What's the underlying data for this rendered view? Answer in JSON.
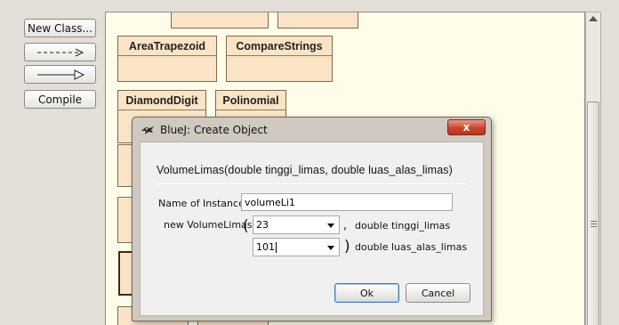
{
  "toolbar": {
    "new_class_label": "New Class...",
    "dependency_arrow_icon": "dashed-arrow-icon",
    "inheritance_arrow_icon": "hollow-arrow-icon",
    "compile_label": "Compile"
  },
  "classes": [
    {
      "name": "AreaTrapezoid"
    },
    {
      "name": "CompareStrings"
    },
    {
      "name": "DiamondDigit"
    },
    {
      "name": "Polinomial"
    }
  ],
  "dialog": {
    "title": "BlueJ:  Create Object",
    "close_label": "x",
    "constructor_signature": "VolumeLimas(double tinggi_limas, double luas_alas_limas)",
    "instance_label": "Name of Instance:",
    "instance_value": "volumeLi1",
    "new_label": "new VolumeLimas",
    "open_paren": "(",
    "close_paren": ")",
    "params": [
      {
        "value": "23",
        "separator": ",",
        "type_label": "double tinggi_limas"
      },
      {
        "value": "101",
        "separator": "",
        "type_label": "double luas_alas_limas"
      }
    ],
    "ok_label": "Ok",
    "cancel_label": "Cancel"
  },
  "colors": {
    "canvas_bg": "#fffde9",
    "class_fill": "#fbe4c6",
    "default_button_border": "#3d7ac2",
    "close_button": "#c6462f"
  }
}
